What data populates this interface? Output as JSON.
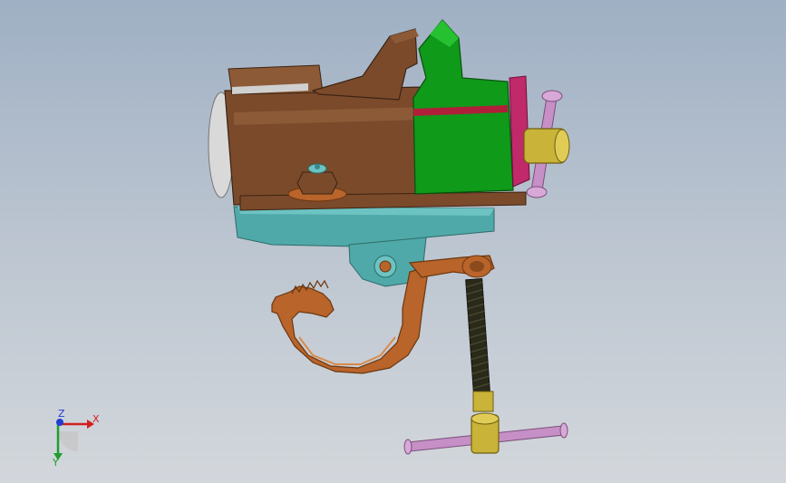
{
  "viewport": {
    "background_top": "#9fb0c4",
    "background_bottom": "#d3d7dc"
  },
  "model": {
    "parts": [
      "base-clamp",
      "vise-body",
      "movable-jaw",
      "jaw-plate",
      "handle-rod",
      "nut",
      "swivel-base",
      "hook-clamp",
      "clamp-arm",
      "clamp-screw",
      "tommy-bar"
    ],
    "colors": {
      "vise_body": "#7a4a2b",
      "vise_body_dark": "#5e3820",
      "movable_jaw": "#0f9a1a",
      "jaw_plate": "#c0296a",
      "swivel_base": "#4fa9a8",
      "hook": "#b8642a",
      "handle_rod": "#c68fc6",
      "handle_collar": "#c9b338",
      "screw": "#2a2a1a"
    }
  },
  "triad": {
    "x_label": "X",
    "y_label": "Y",
    "z_label": "Z",
    "x_color": "#d21f1f",
    "y_color": "#1f9e2f",
    "z_color": "#1f3fd2"
  }
}
